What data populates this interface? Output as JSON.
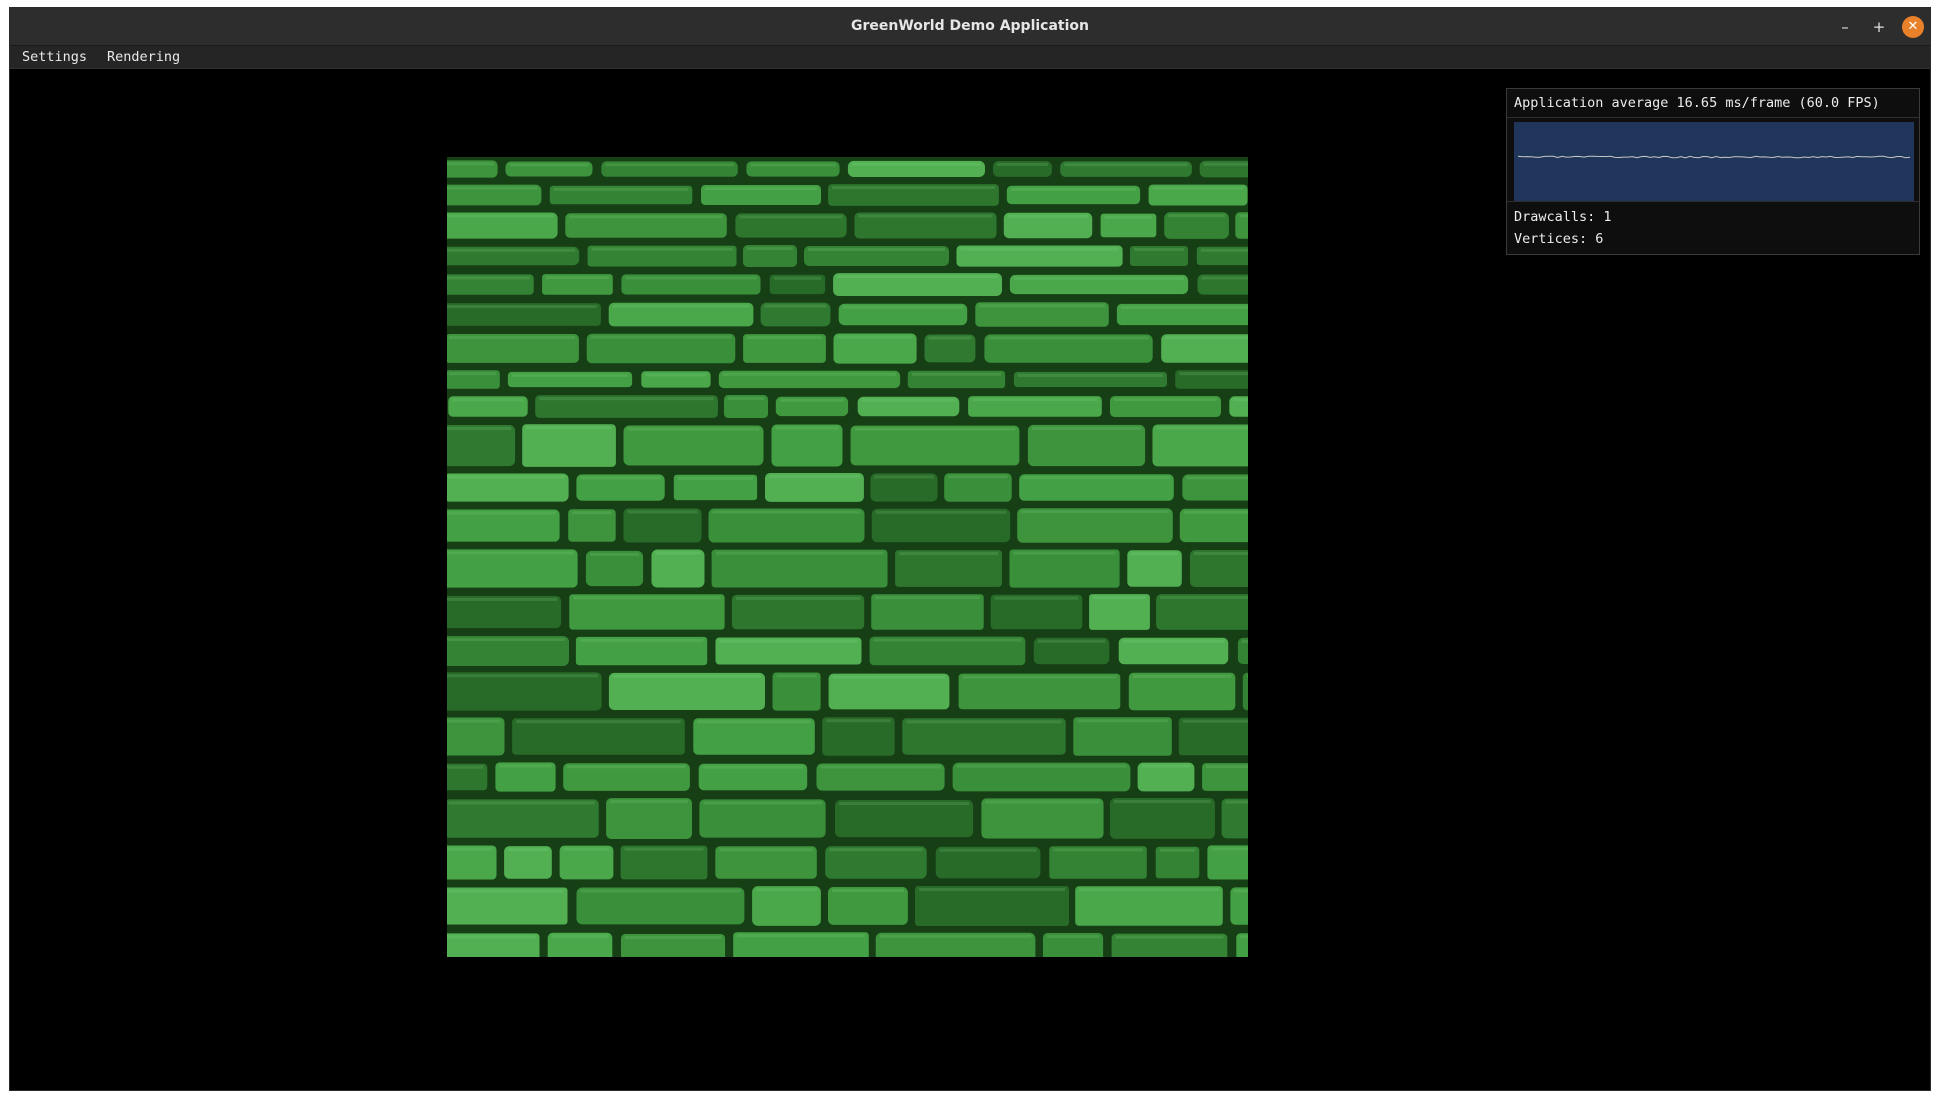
{
  "window": {
    "title": "GreenWorld Demo Application",
    "minimize_glyph": "–",
    "maximize_glyph": "+",
    "close_glyph": "✕"
  },
  "menubar": {
    "items": [
      {
        "label": "Settings"
      },
      {
        "label": "Rendering"
      }
    ]
  },
  "viewport": {
    "texture": "green stone brick wall",
    "texture_color": "#3a8f3a",
    "background": "#000000"
  },
  "stats": {
    "average_text": "Application average 16.65 ms/frame (60.0 FPS)",
    "ms_per_frame": 16.65,
    "fps": 60.0,
    "drawcalls_text": "Drawcalls: 1",
    "drawcalls": 1,
    "vertices_text": "Vertices: 6",
    "vertices": 6,
    "plot_bg_color": "#1f3559",
    "plot_line_color": "#c8c8c8"
  }
}
